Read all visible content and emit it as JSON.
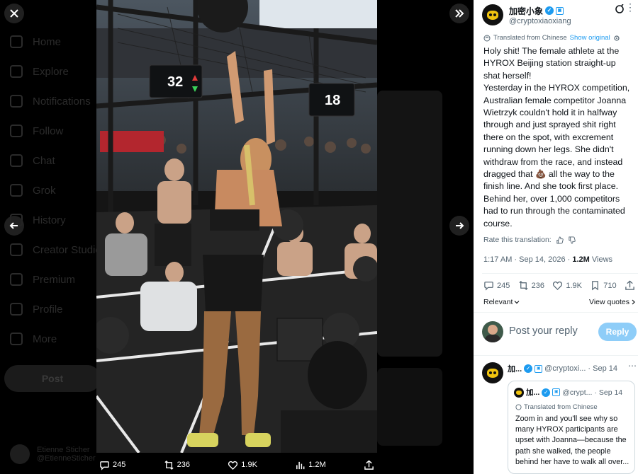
{
  "background": {
    "nav": [
      {
        "label": "Home",
        "icon": "home-icon"
      },
      {
        "label": "Explore",
        "icon": "search-icon"
      },
      {
        "label": "Notifications",
        "icon": "bell-icon"
      },
      {
        "label": "Follow",
        "icon": "follow-icon"
      },
      {
        "label": "Chat",
        "icon": "chat-icon"
      },
      {
        "label": "Grok",
        "icon": "grok-icon"
      },
      {
        "label": "History",
        "icon": "history-icon"
      },
      {
        "label": "Creator Studio",
        "icon": "creator-icon"
      },
      {
        "label": "Premium",
        "icon": "premium-icon"
      },
      {
        "label": "Profile",
        "icon": "profile-icon"
      },
      {
        "label": "More",
        "icon": "more-icon"
      }
    ],
    "post_button": "Post",
    "user_name": "Etienne Sticher",
    "user_handle": "@EtienneSticher"
  },
  "viewer": {
    "close_icon": "close-icon",
    "prev_icon": "arrow-left-icon",
    "next_icon": "arrow-right-icon",
    "collapse_icon": "chevrons-right-icon",
    "photo_scoreboards": [
      "32",
      "18"
    ],
    "actions": {
      "replies": "245",
      "reposts": "236",
      "likes": "1.9K",
      "views": "1.2M"
    }
  },
  "post": {
    "author_name": "加密小象",
    "author_handle": "@cryptoxiaoxiang",
    "translated_label": "Translated from Chinese",
    "show_original": "Show original",
    "body": "Holy shit! The female athlete at the HYROX Beijing station straight-up shat herself!\nYesterday in the HYROX competition, Australian female competitor Joanna Wietrzyk couldn't hold it in halfway through and just sprayed shit right there on the spot, with excrement running down her legs. She didn't withdraw from the race, and instead dragged that 💩 all the way to the finish line. And she took first place.\nBehind her, over 1,000 competitors had to run through the contaminated course.",
    "rate_label": "Rate this translation:",
    "time": "1:17 AM · Sep 14, 2026 · ",
    "views_count": "1.2M",
    "views_label": " Views",
    "stats": {
      "replies": "245",
      "reposts": "236",
      "likes": "1.9K",
      "bookmarks": "710"
    },
    "relevant_label": "Relevant",
    "view_quotes": "View quotes"
  },
  "reply_box": {
    "placeholder": "Post your reply",
    "button": "Reply"
  },
  "reply": {
    "author_name": "加...",
    "handle": "@cryptoxi...",
    "date": "· Sep 14",
    "quote": {
      "author_name": "加...",
      "handle": "@crypt...",
      "date": "· Sep 14",
      "translated_label": "Translated from Chinese",
      "body": "Zoom in and you'll see why so many HYROX participants are upset with Joanna—because the path she walked, the people behind her have to walk all over..."
    }
  },
  "colors": {
    "accent": "#1d9bf0",
    "panel_bg": "#ffffff",
    "overlay_bg": "#000000",
    "reply_button": "#8ecdf8"
  }
}
